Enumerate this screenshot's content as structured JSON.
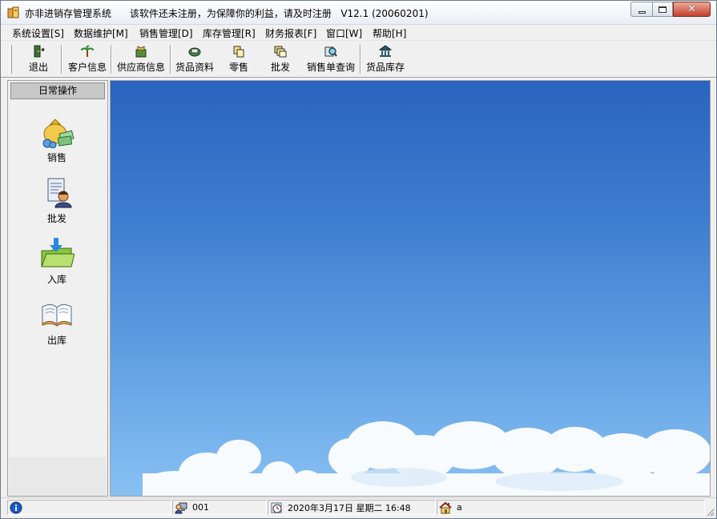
{
  "window": {
    "title": "亦非进销存管理系统      该软件还未注册，为保障你的利益，请及时注册   V12.1 (20060201)",
    "close_glyph": "✕"
  },
  "menu": [
    {
      "label": "系统设置[S]"
    },
    {
      "label": "数据维护[M]"
    },
    {
      "label": "销售管理[D]"
    },
    {
      "label": "库存管理[R]"
    },
    {
      "label": "财务报表[F]"
    },
    {
      "label": "窗口[W]"
    },
    {
      "label": "帮助[H]"
    }
  ],
  "toolbar": [
    {
      "label": "退出",
      "icon": "exit-door-icon"
    },
    {
      "label": "客户信息",
      "icon": "palm-tree-icon"
    },
    {
      "label": "供应商信息",
      "icon": "supplier-box-icon"
    },
    {
      "label": "货品资料",
      "icon": "goods-book-icon"
    },
    {
      "label": "零售",
      "icon": "copy-pages-icon"
    },
    {
      "label": "批发",
      "icon": "stacked-pages-icon"
    },
    {
      "label": "销售单查询",
      "icon": "magnifier-icon"
    },
    {
      "label": "货品库存",
      "icon": "bank-icon"
    }
  ],
  "left_panel": {
    "header": "日常操作",
    "items": [
      {
        "label": "销售",
        "icon": "money-bag-icon"
      },
      {
        "label": "批发",
        "icon": "document-person-icon"
      },
      {
        "label": "入库",
        "icon": "folder-download-icon"
      },
      {
        "label": "出库",
        "icon": "open-book-icon"
      }
    ]
  },
  "status": {
    "user_id": "001",
    "datetime": "2020年3月17日  星期二  16:48",
    "user_name": "a"
  },
  "colors": {
    "sky_top": "#2a63bf",
    "sky_bottom": "#88c0f2",
    "close_button": "#c7412b"
  }
}
